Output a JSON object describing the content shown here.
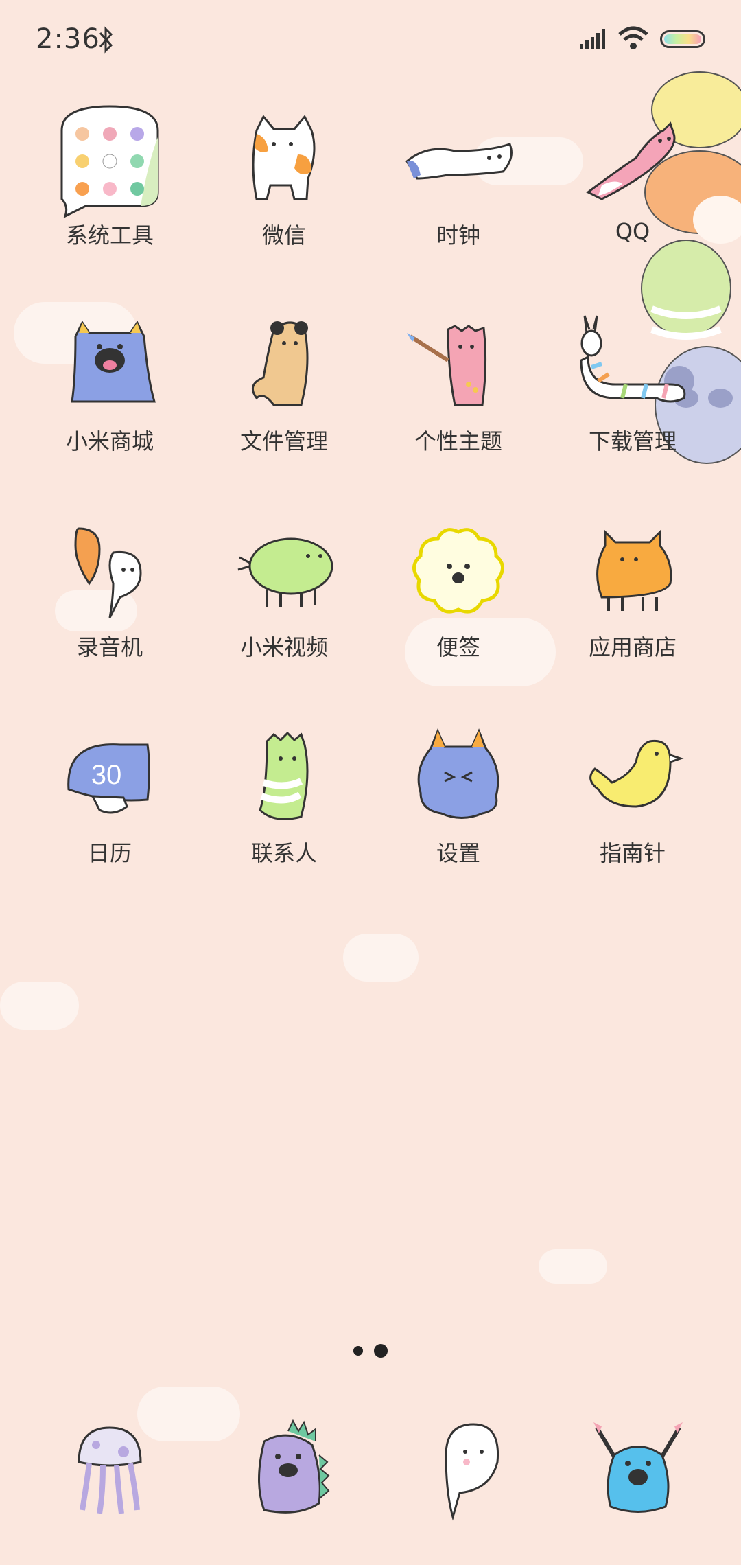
{
  "status": {
    "time": "2:36"
  },
  "colors": {
    "background": "#fbe7de",
    "cloud": "#fdf4ef"
  },
  "apps": [
    {
      "label": "系统工具",
      "icon": "folder-icon"
    },
    {
      "label": "微信",
      "icon": "cat-icon"
    },
    {
      "label": "时钟",
      "icon": "sock-icon"
    },
    {
      "label": "QQ",
      "icon": "pink-creature-icon"
    },
    {
      "label": "小米商城",
      "icon": "blue-monster-icon"
    },
    {
      "label": "文件管理",
      "icon": "otter-icon"
    },
    {
      "label": "个性主题",
      "icon": "painter-icon"
    },
    {
      "label": "下载管理",
      "icon": "striped-worm-icon"
    },
    {
      "label": "录音机",
      "icon": "balloons-icon"
    },
    {
      "label": "小米视频",
      "icon": "green-pig-icon"
    },
    {
      "label": "便签",
      "icon": "flower-icon"
    },
    {
      "label": "应用商店",
      "icon": "orange-bull-icon"
    },
    {
      "label": "日历",
      "icon": "calendar-mushroom-icon",
      "badge": "30"
    },
    {
      "label": "联系人",
      "icon": "green-ghost-icon"
    },
    {
      "label": "设置",
      "icon": "blue-devil-icon"
    },
    {
      "label": "指南针",
      "icon": "yellow-bird-icon"
    }
  ],
  "page_indicator": {
    "pages": 2,
    "current": 2
  },
  "dock": [
    {
      "icon": "jellyfish-icon"
    },
    {
      "icon": "purple-dino-icon"
    },
    {
      "icon": "ghost-icon"
    },
    {
      "icon": "blue-monster-cheer-icon"
    }
  ]
}
